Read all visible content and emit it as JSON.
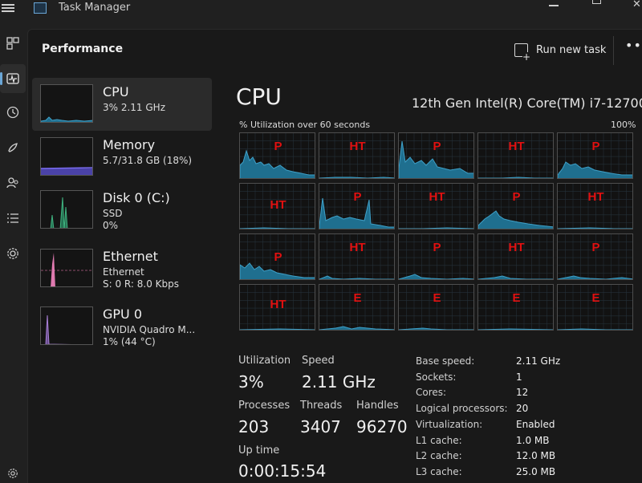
{
  "window": {
    "title": "Task Manager"
  },
  "header": {
    "title": "Performance",
    "run_new_task": "Run new task",
    "more": "•••"
  },
  "devices": [
    {
      "name": "CPU",
      "sub1": "3% 2.11 GHz",
      "sub2": "",
      "color": "#3ea0c8"
    },
    {
      "name": "Memory",
      "sub1": "5.7/31.8 GB (18%)",
      "sub2": "",
      "color": "#7a6cf0"
    },
    {
      "name": "Disk 0 (C:)",
      "sub1": "SSD",
      "sub2": "0%",
      "color": "#3fb27f"
    },
    {
      "name": "Ethernet",
      "sub1": "Ethernet",
      "sub2": "S: 0 R: 8.0 Kbps",
      "color": "#e07ab0"
    },
    {
      "name": "GPU 0",
      "sub1": "NVIDIA Quadro M...",
      "sub2": "1% (44 °C)",
      "color": "#a87fd6"
    }
  ],
  "cpu": {
    "title": "CPU",
    "model": "12th Gen Intel(R) Core(TM) i7-12700",
    "util_caption": "% Utilization over 60 seconds",
    "util_max": "100%",
    "core_labels": [
      "P",
      "HT",
      "P",
      "HT",
      "P",
      "HT",
      "P",
      "HT",
      "P",
      "HT",
      "P",
      "HT",
      "P",
      "HT",
      "P",
      "HT",
      "E",
      "E",
      "E",
      "E"
    ],
    "stats": {
      "utilization_label": "Utilization",
      "utilization": "3%",
      "speed_label": "Speed",
      "speed": "2.11 GHz",
      "processes_label": "Processes",
      "processes": "203",
      "threads_label": "Threads",
      "threads": "3407",
      "handles_label": "Handles",
      "handles": "96270",
      "uptime_label": "Up time",
      "uptime": "0:00:15:54"
    },
    "specs": [
      {
        "label": "Base speed:",
        "value": "2.11 GHz"
      },
      {
        "label": "Sockets:",
        "value": "1"
      },
      {
        "label": "Cores:",
        "value": "12"
      },
      {
        "label": "Logical processors:",
        "value": "20"
      },
      {
        "label": "Virtualization:",
        "value": "Enabled"
      },
      {
        "label": "L1 cache:",
        "value": "1.0 MB"
      },
      {
        "label": "L2 cache:",
        "value": "12.0 MB"
      },
      {
        "label": "L3 cache:",
        "value": "25.0 MB"
      }
    ]
  },
  "colors": {
    "accent": "#6aa6d6",
    "graph": "#3ea0c8",
    "label_red": "#e01010"
  }
}
